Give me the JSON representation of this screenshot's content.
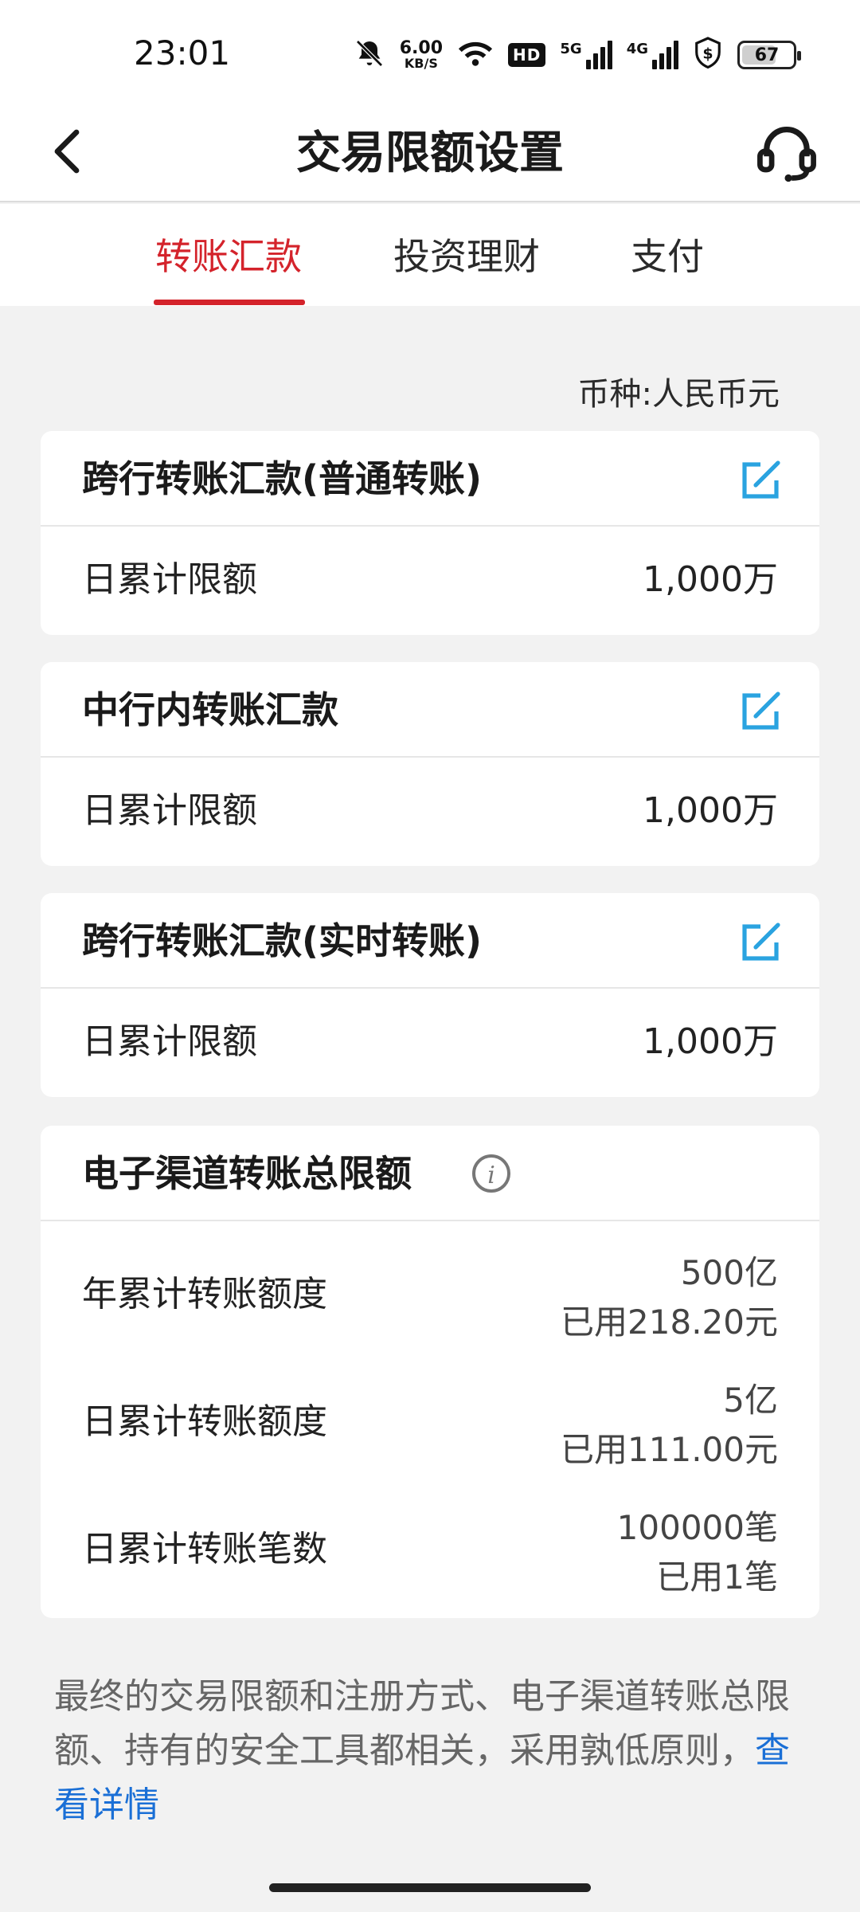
{
  "status_bar": {
    "time": "23:01",
    "net_speed_value": "6.00",
    "net_speed_unit": "KB/S",
    "hd_badge": "HD",
    "net1_label": "5G",
    "net2_label": "4G",
    "battery_level": "67",
    "battery_fraction": 0.67,
    "icons": [
      "mute-bell-icon",
      "wifi-icon",
      "shield-dollar-icon",
      "battery-icon"
    ]
  },
  "header": {
    "title": "交易限额设置",
    "back_icon": "chevron-left-icon",
    "support_icon": "headset-icon"
  },
  "tabs": [
    {
      "label": "转账汇款",
      "active": true
    },
    {
      "label": "投资理财",
      "active": false
    },
    {
      "label": "支付",
      "active": false
    }
  ],
  "currency_note": "币种:人民币元",
  "cards": [
    {
      "title": "跨行转账汇款(普通转账)",
      "row_label": "日累计限额",
      "row_value": "1,000万"
    },
    {
      "title": "中行内转账汇款",
      "row_label": "日累计限额",
      "row_value": "1,000万"
    },
    {
      "title": "跨行转账汇款(实时转账)",
      "row_label": "日累计限额",
      "row_value": "1,000万"
    }
  ],
  "total_limit": {
    "title": "电子渠道转账总限额",
    "rows": [
      {
        "label": "年累计转账额度",
        "limit": "500亿",
        "used": "已用218.20元"
      },
      {
        "label": "日累计转账额度",
        "limit": "5亿",
        "used": "已用111.00元"
      },
      {
        "label": "日累计转账笔数",
        "limit": "100000笔",
        "used": "已用1笔"
      }
    ]
  },
  "footer": {
    "note_text": "最终的交易限额和注册方式、电子渠道转账总限额、持有的安全工具都相关，采用孰低原则，",
    "link_text": "查看详情"
  },
  "colors": {
    "accent_red": "#d4232b",
    "edit_blue": "#2aa3e0",
    "link_blue": "#1a6fd6"
  }
}
